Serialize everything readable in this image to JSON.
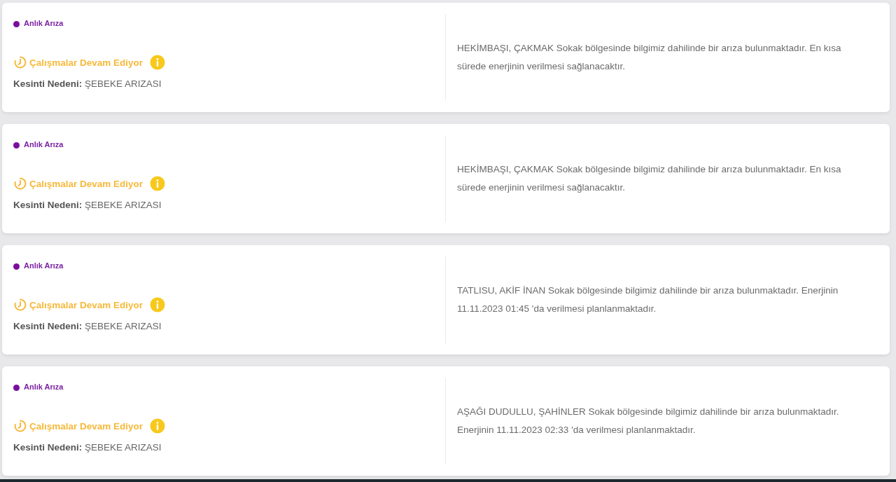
{
  "outages": [
    {
      "type_label": "Anlık Arıza",
      "color": "#7a0f9e",
      "status": "Çalışmalar Devam Ediyor",
      "reason": "**Kesinti Nedeni:** ŞEBEKE ARIZASI",
      "description": "HEKİMBAŞI, ÇAKMAK Sokak bölgesinde bilgimiz dahilinde bir arıza bulunmaktadır. En kısa sürede enerjinin verilmesi sağlanacaktır."
    },
    {
      "type_label": "Anlık Arıza",
      "color": "#7a0f9e",
      "status": "Çalışmalar Devam Ediyor",
      "reason": "**Kesinti Nedeni:** ŞEBEKE ARIZASI",
      "description": "HEKİMBAŞI, ÇAKMAK Sokak bölgesinde bilgimiz dahilinde bir arıza bulunmaktadır. En kısa sürede enerjinin verilmesi sağlanacaktır."
    },
    {
      "type_label": "Anlık Arıza",
      "color": "#7a0f9e",
      "status": "Çalışmalar Devam Ediyor",
      "reason": "**Kesinti Nedeni:** ŞEBEKE ARIZASI",
      "description": "TATLISU, AKİF İNAN Sokak bölgesinde bilgimiz dahilinde bir arıza bulunmaktadır. Enerjinin 11.11.2023 01:45 'da verilmesi planlanmaktadır."
    },
    {
      "type_label": "Anlık Arıza",
      "color": "#7a0f9e",
      "status": "Çalışmalar Devam Ediyor",
      "reason": "**Kesinti Nedeni:** ŞEBEKE ARIZASI",
      "description": "AŞAĞI DUDULLU, ŞAHİNLER Sokak bölgesinde bilgimiz dahilinde bir arıza bulunmaktadır. Enerjinin 11.11.2023 02:33 'da verilmesi planlanmaktadır."
    }
  ]
}
